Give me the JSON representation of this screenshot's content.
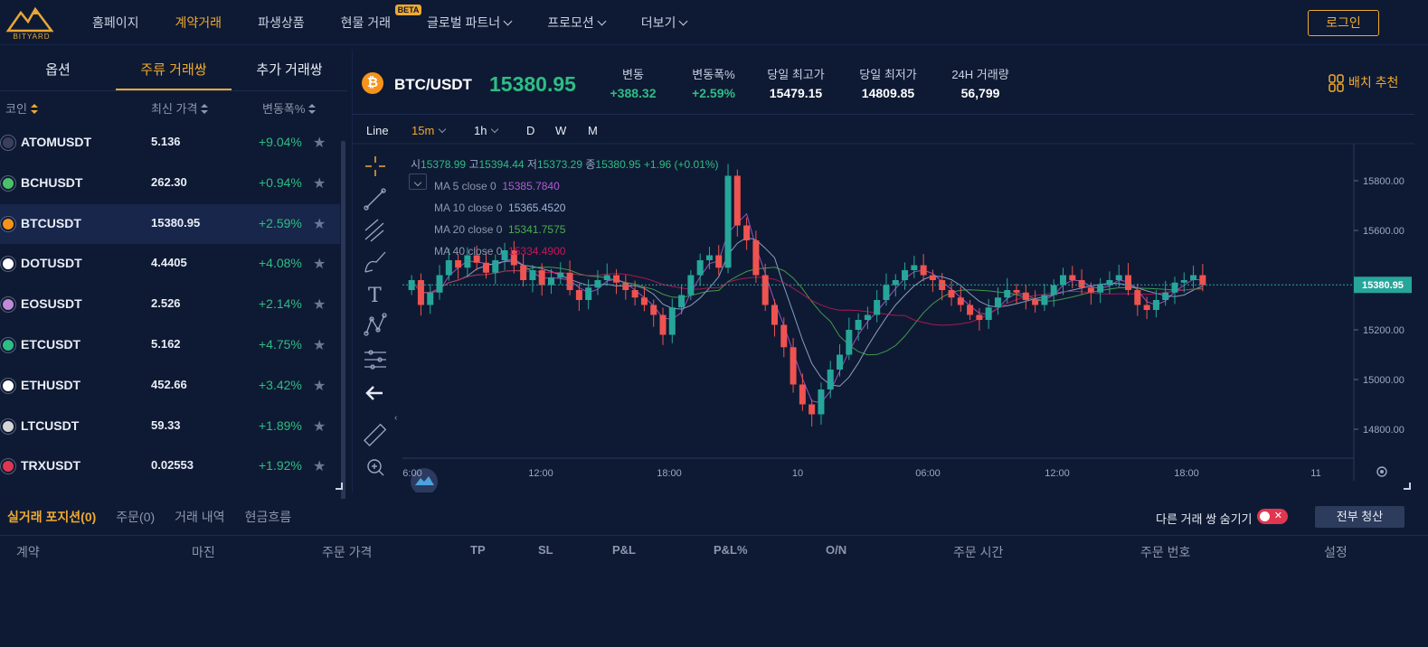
{
  "header": {
    "logo_text": "BITYARD",
    "nav": [
      {
        "label": "홈페이지"
      },
      {
        "label": "계약거래"
      },
      {
        "label": "파생상품"
      },
      {
        "label": "현물 거래"
      },
      {
        "label": "글로벌 파트너"
      },
      {
        "label": "프로모션"
      },
      {
        "label": "더보기"
      }
    ],
    "beta": "BETA",
    "login": "로그인"
  },
  "market": {
    "tabs": [
      "옵션",
      "주류 거래쌍",
      "추가 거래쌍"
    ],
    "col_coin": "코인",
    "col_price": "최신 가격",
    "col_change": "변동폭%",
    "rows": [
      {
        "name": "ATOMUSDT",
        "price": "5.136",
        "change": "+9.04%",
        "icon_color": "#3b3f5c"
      },
      {
        "name": "BCHUSDT",
        "price": "262.30",
        "change": "+0.94%",
        "icon_color": "#4bc06a"
      },
      {
        "name": "BTCUSDT",
        "price": "15380.95",
        "change": "+2.59%",
        "icon_color": "#f7931a"
      },
      {
        "name": "DOTUSDT",
        "price": "4.4405",
        "change": "+4.08%",
        "icon_color": "#ffffff"
      },
      {
        "name": "EOSUSDT",
        "price": "2.526",
        "change": "+2.14%",
        "icon_color": "#c08ad6"
      },
      {
        "name": "ETCUSDT",
        "price": "5.162",
        "change": "+4.75%",
        "icon_color": "#2ebd85"
      },
      {
        "name": "ETHUSDT",
        "price": "452.66",
        "change": "+3.42%",
        "icon_color": "#ffffff"
      },
      {
        "name": "LTCUSDT",
        "price": "59.33",
        "change": "+1.89%",
        "icon_color": "#d5d5d5"
      },
      {
        "name": "TRXUSDT",
        "price": "0.02553",
        "change": "+1.92%",
        "icon_color": "#e0364f"
      }
    ]
  },
  "ticker": {
    "pair": "BTC/USDT",
    "price": "15380.95",
    "stats": [
      {
        "label": "변동",
        "value": "+388.32",
        "green": true
      },
      {
        "label": "변동폭%",
        "value": "+2.59%",
        "green": true
      },
      {
        "label": "당일 최고가",
        "value": "15479.15",
        "green": false
      },
      {
        "label": "당일 최저가",
        "value": "14809.85",
        "green": false
      },
      {
        "label": "24H 거래량",
        "value": "56,799",
        "green": false
      }
    ],
    "layout_rec": "배치 추천"
  },
  "chart_toolbar": {
    "line": "Line",
    "interval1": "15m",
    "interval2": "1h",
    "d": "D",
    "w": "W",
    "m": "M"
  },
  "chart_data": {
    "type": "candlestick",
    "ohlc_text": {
      "open_label": "시",
      "open": "15378.99",
      "high_label": "고",
      "high": "15394.44",
      "low_label": "저",
      "low": "15373.29",
      "close_label": "종",
      "close": "15380.95",
      "change": "+1.96 (+0.01%)"
    },
    "ma": [
      {
        "label": "MA 5 close 0",
        "value": "15385.7840",
        "color": "#b45bd8"
      },
      {
        "label": "MA 10 close 0",
        "value": "15365.4520",
        "color": "#9fb3d9"
      },
      {
        "label": "MA 20 close 0",
        "value": "15341.7575",
        "color": "#4caf50"
      },
      {
        "label": "MA 40 close 0",
        "value": "15334.4900",
        "color": "#c2185b"
      }
    ],
    "y_ticks": [
      "15800.00",
      "15600.00",
      "15400.00",
      "15200.00",
      "15000.00",
      "14800.00"
    ],
    "ylim": [
      14720,
      15920
    ],
    "x_ticks": [
      "6:00",
      "12:00",
      "18:00",
      "10",
      "06:00",
      "12:00",
      "18:00",
      "11"
    ],
    "last_price": 15380.95,
    "last_price_label": "15380.95",
    "closes": [
      15400,
      15300,
      15350,
      15420,
      15480,
      15450,
      15500,
      15470,
      15430,
      15480,
      15520,
      15460,
      15400,
      15440,
      15380,
      15410,
      15430,
      15360,
      15320,
      15370,
      15400,
      15420,
      15390,
      15360,
      15330,
      15300,
      15260,
      15180,
      15290,
      15340,
      15420,
      15480,
      15500,
      15450,
      15820,
      15620,
      15560,
      15420,
      15300,
      15220,
      15130,
      14980,
      14900,
      14860,
      14960,
      15040,
      15100,
      15200,
      15240,
      15260,
      15320,
      15380,
      15400,
      15440,
      15460,
      15420,
      15400,
      15360,
      15330,
      15300,
      15260,
      15240,
      15290,
      15330,
      15360,
      15350,
      15320,
      15300,
      15340,
      15380,
      15420,
      15400,
      15370,
      15350,
      15380,
      15400,
      15420,
      15360,
      15300,
      15280,
      15320,
      15350,
      15390,
      15400,
      15420,
      15380
    ]
  },
  "bottom": {
    "tabs": [
      "실거래 포지션(0)",
      "주문(0)",
      "거래 내역",
      "현금흐름"
    ],
    "hide_label": "다른 거래 쌍 숨기기",
    "toggle_x": "✕",
    "close_all": "전부 청산",
    "columns": [
      "계약",
      "마진",
      "주문 가격",
      "TP",
      "SL",
      "P&L",
      "P&L%",
      "O/N",
      "주문 시간",
      "주문 번호",
      "설정"
    ]
  }
}
